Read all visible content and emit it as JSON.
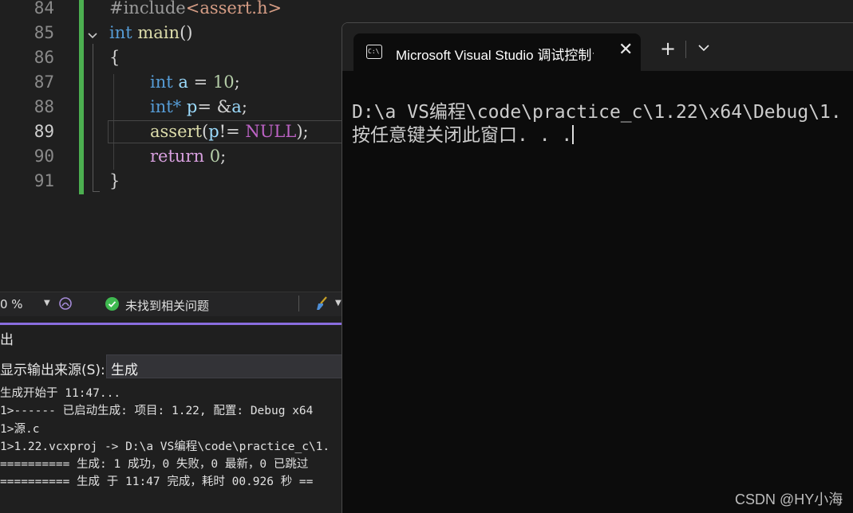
{
  "editor": {
    "line_numbers": [
      "84",
      "85",
      "86",
      "87",
      "88",
      "89",
      "90",
      "91"
    ],
    "line84": {
      "directive": "#include",
      "header": "<assert.h>"
    },
    "line85": {
      "type": "int",
      "name": "main",
      "parens": "()"
    },
    "line86": {
      "brace": "{"
    },
    "line87": {
      "type": "int",
      "var": "a",
      "op": " = ",
      "num": "10",
      "end": ";"
    },
    "line88": {
      "type": "int*",
      "var": " p",
      "op": "= &",
      "var2": "a",
      "end": ";"
    },
    "line89": {
      "fn": "assert",
      "open": "(",
      "var": "p",
      "op": "!= ",
      "macro": "NULL",
      "end": ");"
    },
    "line90": {
      "kw": "return",
      "num": "0",
      "end": ";"
    },
    "line91": {
      "brace": "}"
    }
  },
  "status_bar": {
    "zoom": "0 %",
    "issues": "未找到相关问题",
    "icons": [
      "copilot-icon",
      "check-circle-icon",
      "clean-brush-icon"
    ]
  },
  "output": {
    "title": "出",
    "source_label": "显示输出来源(S):",
    "source_value": "生成",
    "lines": [
      "生成开始于 11:47...",
      "1>------ 已启动生成: 项目: 1.22, 配置: Debug x64",
      "1>源.c",
      "1>1.22.vcxproj -> D:\\a VS编程\\code\\practice_c\\1.",
      "========== 生成: 1 成功，0 失败，0 最新，0 已跳过",
      "========== 生成 于 11:47 完成，耗时 00.926 秒 =="
    ]
  },
  "terminal": {
    "tab_title": "Microsoft Visual Studio 调试控制台",
    "tab_icon_text": "C:\\",
    "close_glyph": "✕",
    "new_tab_glyph": "+",
    "path_line": "D:\\a VS编程\\code\\practice_c\\1.22\\x64\\Debug\\1.",
    "prompt_line": "按任意键关闭此窗口. . ."
  },
  "watermark": "CSDN @HY小海"
}
